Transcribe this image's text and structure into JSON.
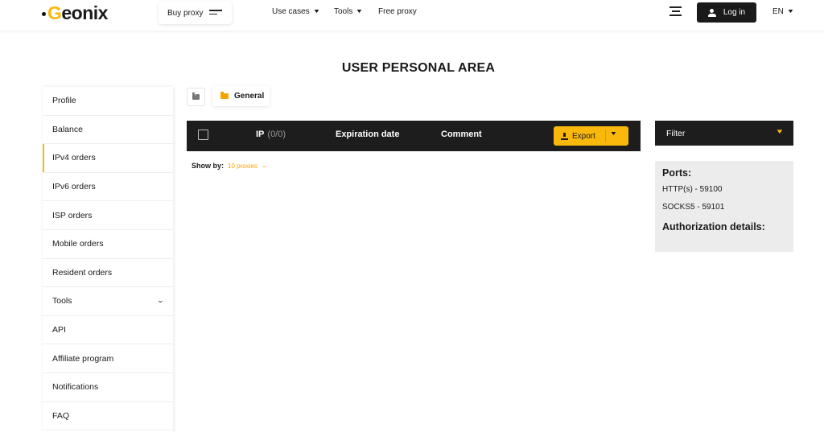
{
  "header": {
    "logo": {
      "first": "G",
      "rest": "eonix"
    },
    "buy_proxy": "Buy proxy",
    "nav": [
      {
        "label": "Use cases",
        "chevron": true
      },
      {
        "label": "Tools",
        "chevron": true
      },
      {
        "label": "Free proxy",
        "chevron": false
      }
    ],
    "login": "Log in",
    "language": "EN"
  },
  "page_title": "USER PERSONAL AREA",
  "sidebar": {
    "items": [
      {
        "label": "Profile"
      },
      {
        "label": "Balance"
      },
      {
        "label": "IPv4 orders",
        "active": true
      },
      {
        "label": "IPv6 orders"
      },
      {
        "label": "ISP orders"
      },
      {
        "label": "Mobile orders"
      },
      {
        "label": "Resident orders"
      },
      {
        "label": "Tools",
        "expandable": true
      },
      {
        "label": "API"
      },
      {
        "label": "Affiliate program"
      },
      {
        "label": "Notifications"
      },
      {
        "label": "FAQ"
      }
    ]
  },
  "folders": {
    "current": "General"
  },
  "table": {
    "columns": {
      "ip": "IP",
      "ip_count": "(0/0)",
      "expiration": "Expiration date",
      "comment": "Comment"
    },
    "export": "Export"
  },
  "show_by": {
    "label": "Show by:",
    "value": "10 proxies"
  },
  "filter": {
    "label": "Filter"
  },
  "ports": {
    "title": "Ports:",
    "http": "HTTP(s) - 59100",
    "socks": "SOCKS5 - 59101",
    "auth_title": "Authorization details:"
  },
  "colors": {
    "accent": "#f9b80b",
    "dark": "#1d1d1d",
    "panel": "#ececec"
  }
}
